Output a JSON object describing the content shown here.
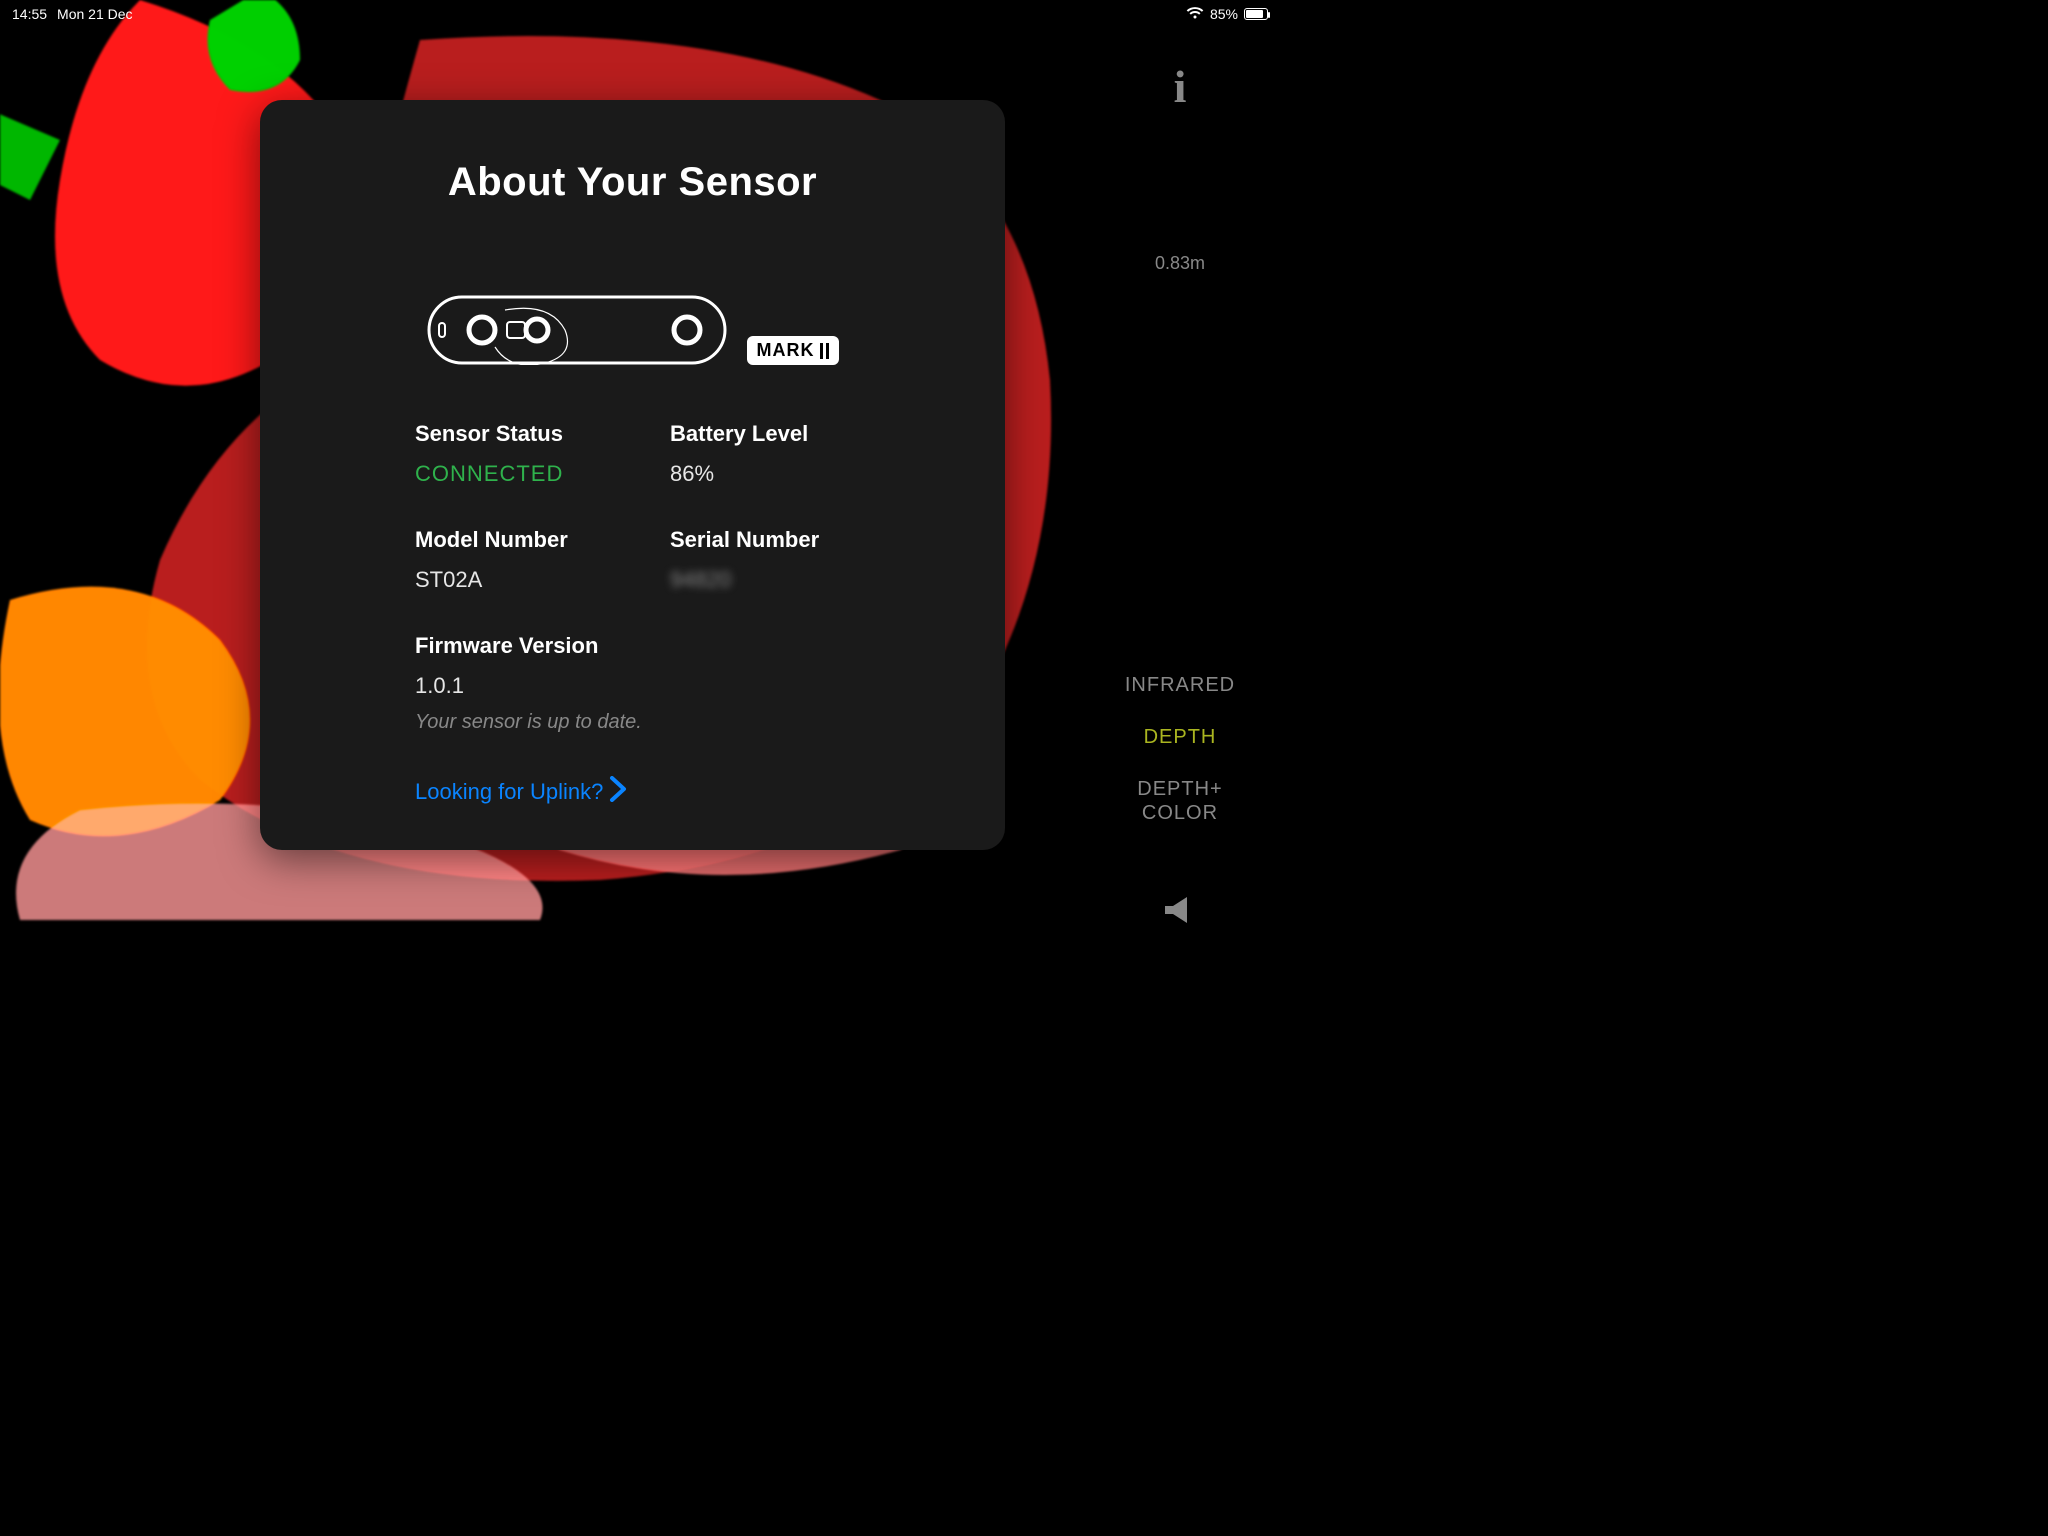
{
  "status_bar": {
    "time": "14:55",
    "date": "Mon 21 Dec",
    "battery_pct_text": "85%",
    "battery_fill_pct": 85
  },
  "side": {
    "distance": "0.83m",
    "modes": {
      "infrared": "INFRARED",
      "depth": "DEPTH",
      "depth_color": "DEPTH+\nCOLOR"
    }
  },
  "modal": {
    "title": "About Your Sensor",
    "badge": "MARK",
    "fields": {
      "status_label": "Sensor Status",
      "status_value": "CONNECTED",
      "battery_label": "Battery Level",
      "battery_value": "86%",
      "model_label": "Model Number",
      "model_value": "ST02A",
      "serial_label": "Serial Number",
      "serial_value": "94820",
      "fw_label": "Firmware Version",
      "fw_value": "1.0.1",
      "fw_note": "Your sensor is up to date."
    },
    "uplink": "Looking for Uplink?"
  },
  "colors": {
    "connected_green": "#2fb24c",
    "link_blue": "#0a84ff",
    "active_mode": "#aab520"
  }
}
